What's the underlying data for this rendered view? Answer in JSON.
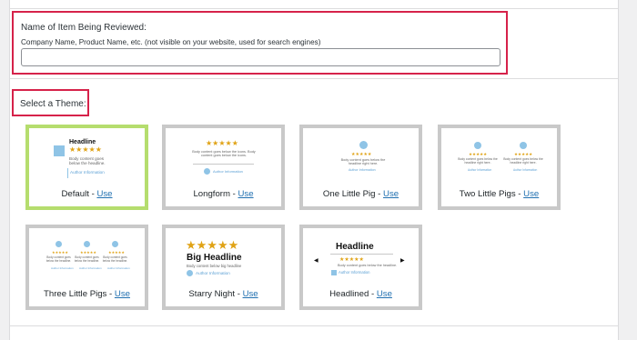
{
  "name_field": {
    "label": "Name of Item Being Reviewed:",
    "help": "Company Name, Product Name, etc. (not visible on your website, used for search engines)",
    "value": "",
    "placeholder": ""
  },
  "theme_section": {
    "label": "Select a Theme:"
  },
  "use_label": "Use",
  "separator": " - ",
  "themes": [
    {
      "name": "Default",
      "selected": true
    },
    {
      "name": "Longform",
      "selected": false
    },
    {
      "name": "One Little Pig",
      "selected": false
    },
    {
      "name": "Two Little Pigs",
      "selected": false
    },
    {
      "name": "Three Little Pigs",
      "selected": false
    },
    {
      "name": "Starry Night",
      "selected": false
    },
    {
      "name": "Headlined",
      "selected": false
    }
  ],
  "previews": {
    "headline": "Headline",
    "big_headline": "Big Headline",
    "stars": "★★★★★",
    "body_short": "Body content goes below the headline.",
    "body_long": "Body content goes below the icons. Body content goes below the icons.",
    "body_pig": "Body content goes below the headline right here.",
    "body_starry": "Body content below big headline",
    "author": "Author Information"
  },
  "colors": {
    "highlight_border": "#d6224a",
    "selected_border": "#b5dd6e",
    "link": "#2271b1",
    "star": "#e0a316",
    "accent_blue": "#8fc4e6"
  }
}
